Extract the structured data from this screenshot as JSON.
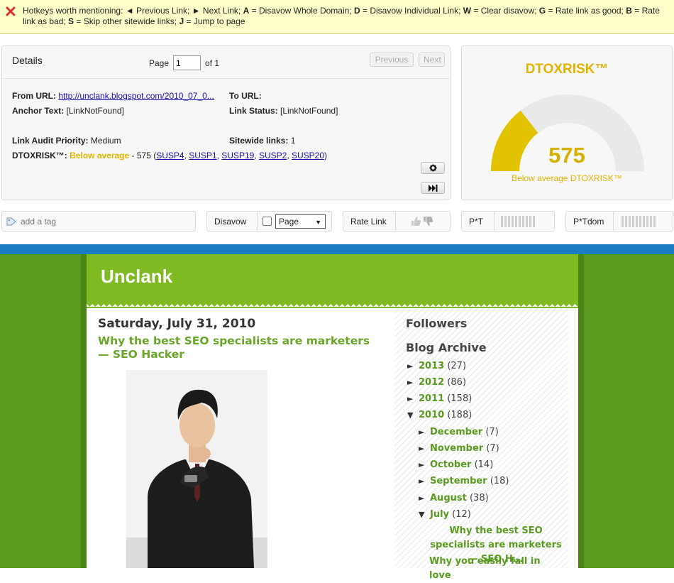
{
  "hotkeys": {
    "intro": "Hotkeys worth mentioning: ",
    "items": [
      {
        "key": "◄",
        "desc": " Previous Link; "
      },
      {
        "key": "►",
        "desc": " Next Link; "
      },
      {
        "key": "A",
        "desc": " = Disavow Whole Domain; "
      },
      {
        "key": "D",
        "desc": " = Disavow Individual Link; "
      },
      {
        "key": "W",
        "desc": " = Clear disavow; "
      },
      {
        "key": "G",
        "desc": " = Rate link as good; "
      },
      {
        "key": "B",
        "desc": " = Rate link as bad; "
      },
      {
        "key": "S",
        "desc": " = Skip other sitewide links; "
      },
      {
        "key": "J",
        "desc": " = Jump to page"
      }
    ]
  },
  "details": {
    "title": "Details",
    "page_label": "Page",
    "page_value": "1",
    "page_of": "of 1",
    "prev_label": "Previous",
    "next_label": "Next",
    "from_url_label": "From URL:",
    "from_url_value": "http://unclank.blogspot.com/2010_07_0...",
    "to_url_label": "To URL:",
    "anchor_label": "Anchor Text:",
    "anchor_value": "[LinkNotFound]",
    "link_status_label": "Link Status:",
    "link_status_value": "[LinkNotFound]",
    "priority_label": "Link Audit Priority:",
    "priority_value": "Medium",
    "sitewide_label": "Sitewide links:",
    "sitewide_value": "1",
    "dtox_label": "DTOXRISK™:",
    "dtox_word": "Below average",
    "dtox_score_text": " - 575 (",
    "susp": [
      "SUSP4",
      "SUSP1",
      "SUSP19",
      "SUSP2",
      "SUSP20"
    ],
    "dtox_close": ")"
  },
  "risk": {
    "title": "DTOXRISK™",
    "value": "575",
    "caption": "Below average DTOXRISK™",
    "fraction": 0.29,
    "fill_color": "#e2c300",
    "track_color": "#e9e9e9"
  },
  "actions": {
    "tag_placeholder": "add a tag",
    "disavow_label": "Disavow",
    "disavow_select": "Page",
    "rate_label": "Rate Link",
    "pt_label": "P*T",
    "ptdom_label": "P*Tdom"
  },
  "blog": {
    "name": "Unclank",
    "post_date": "Saturday, July 31, 2010",
    "post_title": "Why the best SEO specialists are marketers — SEO Hacker",
    "followers_heading": "Followers",
    "archive_heading": "Blog Archive",
    "archive": [
      {
        "tri": "►",
        "label": "2013",
        "count": "(27)"
      },
      {
        "tri": "►",
        "label": "2012",
        "count": "(86)"
      },
      {
        "tri": "►",
        "label": "2011",
        "count": "(158)"
      },
      {
        "tri": "▼",
        "label": "2010",
        "count": "(188)"
      }
    ],
    "months": [
      {
        "tri": "►",
        "label": "December",
        "count": "(7)"
      },
      {
        "tri": "►",
        "label": "November",
        "count": "(7)"
      },
      {
        "tri": "►",
        "label": "October",
        "count": "(14)"
      },
      {
        "tri": "►",
        "label": "September",
        "count": "(18)"
      },
      {
        "tri": "►",
        "label": "August",
        "count": "(38)"
      },
      {
        "tri": "▼",
        "label": "July",
        "count": "(12)"
      }
    ],
    "posts": [
      "Why the best SEO specialists are marketers — SEO H...",
      "Why you easily fall in love"
    ]
  }
}
